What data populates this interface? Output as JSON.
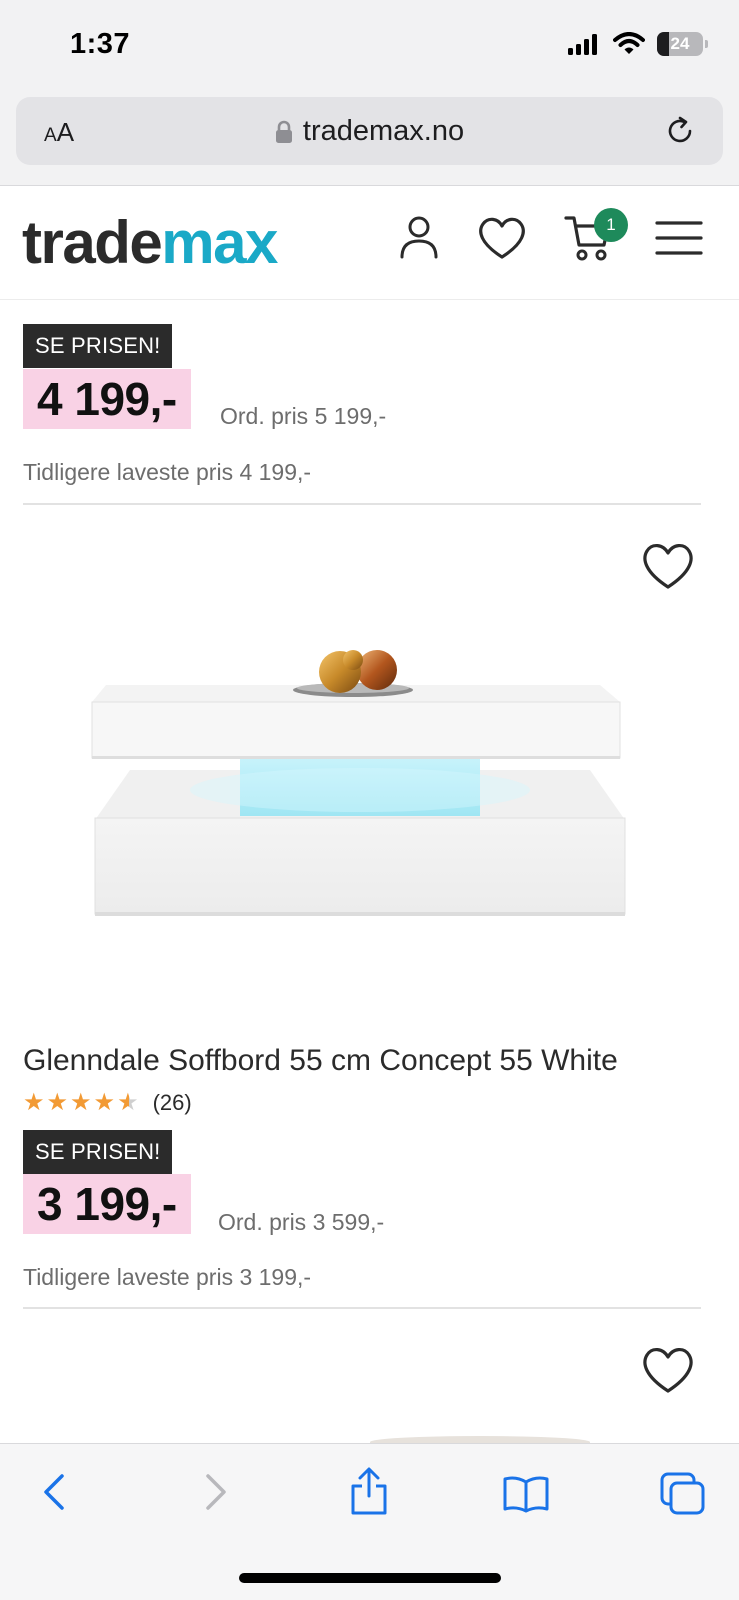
{
  "status_bar": {
    "time": "1:37",
    "battery": "24"
  },
  "browser": {
    "aa_small": "A",
    "aa_large": "A",
    "url": "trademax.no"
  },
  "site": {
    "logo_part1": "trade",
    "logo_part2": "max",
    "cart_count": "1"
  },
  "products": [
    {
      "badge": "SE PRISEN!",
      "price": "4 199,-",
      "ord_price": "Ord. pris 5 199,-",
      "lowest_price": "Tidligere laveste pris 4 199,-"
    },
    {
      "title": "Glenndale Soffbord 55 cm Concept 55 White",
      "rating": 4.5,
      "rating_count": "(26)",
      "badge": "SE PRISEN!",
      "price": "3 199,-",
      "ord_price": "Ord. pris 3 599,-",
      "lowest_price": "Tidligere laveste pris 3 199,-"
    }
  ],
  "colors": {
    "brand_dark": "#2b2b2b",
    "brand_accent": "#1aa9c7",
    "price_highlight": "#f9d2e5",
    "cart_badge": "#1e8a5b",
    "star": "#f29a34",
    "ios_blue": "#1a73e8"
  },
  "icons": {
    "header": [
      "account-icon",
      "heart-icon",
      "cart-icon",
      "menu-icon"
    ],
    "toolbar": [
      "back-icon",
      "forward-icon",
      "share-icon",
      "bookmarks-icon",
      "tabs-icon"
    ]
  }
}
